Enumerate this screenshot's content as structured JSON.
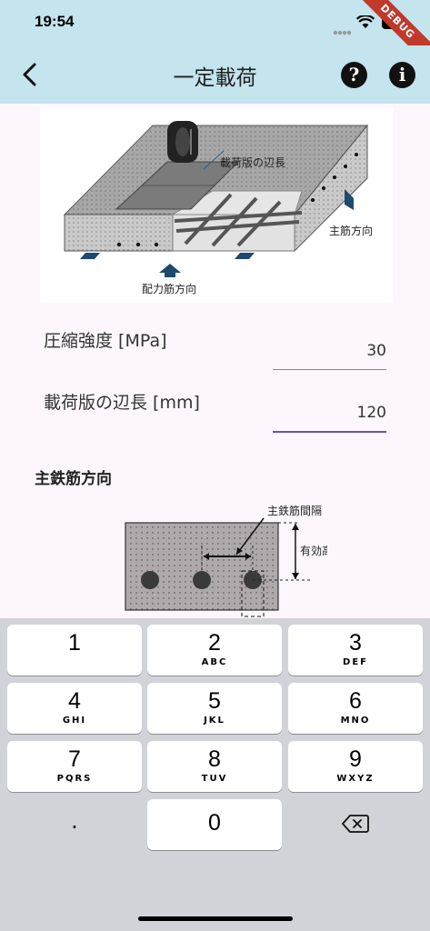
{
  "status": {
    "time": "19:54"
  },
  "appbar": {
    "title": "一定載荷",
    "help_icon": "?",
    "info_icon": "i"
  },
  "debug_banner": "DEBUG",
  "figure1": {
    "label_side": "載荷版の辺長",
    "label_main": "主筋方向",
    "label_dist": "配力筋方向"
  },
  "fields": [
    {
      "label": "圧縮強度 [MPa]",
      "value": "30"
    },
    {
      "label": "載荷版の辺長 [mm]",
      "value": "120"
    }
  ],
  "section_title": "主鉄筋方向",
  "figure2": {
    "label_spacing": "主鉄筋間隔",
    "label_depth": "有効高さ"
  },
  "keyboard": {
    "keys": [
      {
        "n": "1",
        "l": ""
      },
      {
        "n": "2",
        "l": "ABC"
      },
      {
        "n": "3",
        "l": "DEF"
      },
      {
        "n": "4",
        "l": "GHI"
      },
      {
        "n": "5",
        "l": "JKL"
      },
      {
        "n": "6",
        "l": "MNO"
      },
      {
        "n": "7",
        "l": "PQRS"
      },
      {
        "n": "8",
        "l": "TUV"
      },
      {
        "n": "9",
        "l": "WXYZ"
      }
    ],
    "dot": ".",
    "zero": "0"
  }
}
